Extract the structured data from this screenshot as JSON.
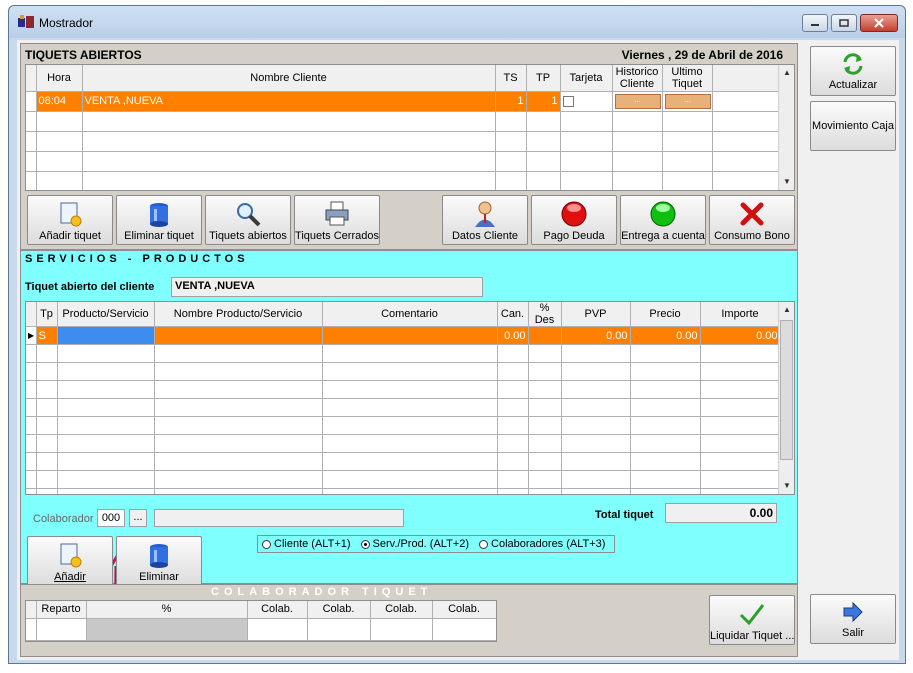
{
  "window": {
    "title": "Mostrador"
  },
  "tiquets": {
    "section_title": "TIQUETS ABIERTOS",
    "date": "Viernes , 29 de Abril de 2016",
    "columns": [
      "Hora",
      "Nombre Cliente",
      "TS",
      "TP",
      "Tarjeta",
      "Historico Cliente",
      "Ultimo Tiquet"
    ],
    "rows": [
      {
        "hora": "08:04",
        "cliente": "VENTA ,NUEVA",
        "ts": "1",
        "tp": "1",
        "btn1": "...",
        "btn2": "..."
      }
    ]
  },
  "toolbar": {
    "add": "Añadir tiquet",
    "delete": "Eliminar tiquet",
    "open": "Tiquets abiertos",
    "closed": "Tiquets Cerrados",
    "client_data": "Datos Cliente",
    "debt": "Pago Deuda",
    "delivery": "Entrega a cuenta",
    "bono": "Consumo Bono"
  },
  "servicios": {
    "section_title": "SERVICIOS - PRODUCTOS",
    "client_label": "Tiquet abierto del cliente",
    "client_value": "VENTA ,NUEVA",
    "columns": [
      "Tp",
      "Producto/Servicio",
      "Nombre Producto/Servicio",
      "Comentario",
      "Can.",
      "% Des",
      "PVP",
      "Precio",
      "Importe"
    ],
    "rows": [
      {
        "tp": "S",
        "cant": "0.00",
        "pvp": "0.00",
        "precio": "0.00",
        "importe": "0.00"
      }
    ],
    "colaborador_label": "Colaborador",
    "colaborador_code": "000",
    "colaborador_btn": "...",
    "total_label": "Total tiquet",
    "total_value": "0.00",
    "add": "Añadir",
    "delete": "Eliminar",
    "radio": [
      "Cliente (ALT+1)",
      "Serv./Prod. (ALT+2)",
      "Colaboradores (ALT+3)"
    ]
  },
  "colaborador": {
    "section_title": "COLABORADOR TIQUET",
    "columns": [
      "Reparto",
      "%",
      "Colab.",
      "Colab.",
      "Colab.",
      "Colab."
    ]
  },
  "side": {
    "refresh": "Actualizar",
    "movement": "Movimiento Caja",
    "liquidate": "Liquidar Tiquet ...",
    "exit": "Salir"
  },
  "colors": {
    "selected_row": "#ff8000",
    "section_bg": "#80ffff",
    "accent_arrow": "#e8005a"
  }
}
